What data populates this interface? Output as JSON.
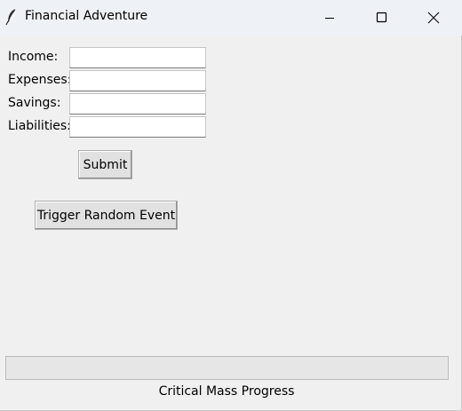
{
  "window": {
    "title": "Financial Adventure",
    "app_icon": "feather-icon",
    "controls": {
      "minimize_icon": "minimize-icon",
      "maximize_icon": "maximize-icon",
      "close_icon": "close-icon"
    }
  },
  "form": {
    "fields": [
      {
        "label": "Income:",
        "value": ""
      },
      {
        "label": "Expenses:",
        "value": ""
      },
      {
        "label": "Savings:",
        "value": ""
      },
      {
        "label": "Liabilities:",
        "value": ""
      }
    ],
    "submit_label": "Submit"
  },
  "actions": {
    "random_event_label": "Trigger Random Event"
  },
  "progress": {
    "value_percent": 0,
    "label": "Critical Mass Progress"
  },
  "colors": {
    "window_bg": "#f0f0f0",
    "titlebar_bg": "#eef1f6",
    "progress_fill": "#06b025"
  }
}
